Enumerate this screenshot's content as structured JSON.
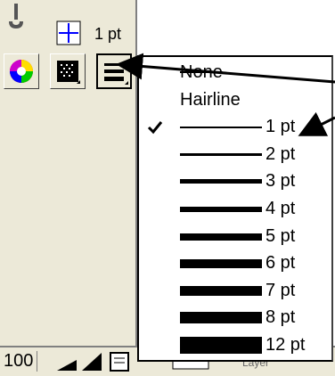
{
  "toolbox": {
    "stroke_size": "1 pt",
    "zoom": "100",
    "status": "Layer"
  },
  "stroke_menu": {
    "items": [
      {
        "label": "None",
        "weight": 0,
        "checked": false
      },
      {
        "label": "Hairline",
        "weight": 0,
        "checked": false
      },
      {
        "label": "1 pt",
        "weight": 1,
        "checked": true
      },
      {
        "label": "2 pt",
        "weight": 2,
        "checked": false
      },
      {
        "label": "3 pt",
        "weight": 3,
        "checked": false
      },
      {
        "label": "4 pt",
        "weight": 4,
        "checked": false
      },
      {
        "label": "5 pt",
        "weight": 5,
        "checked": false
      },
      {
        "label": "6 pt",
        "weight": 6,
        "checked": false
      },
      {
        "label": "7 pt",
        "weight": 7,
        "checked": false
      },
      {
        "label": "8 pt",
        "weight": 8,
        "checked": false
      },
      {
        "label": "12 pt",
        "weight": 12,
        "checked": false
      }
    ]
  },
  "colors": {
    "panel": "#ece9d8",
    "accent": "#0000ff"
  }
}
